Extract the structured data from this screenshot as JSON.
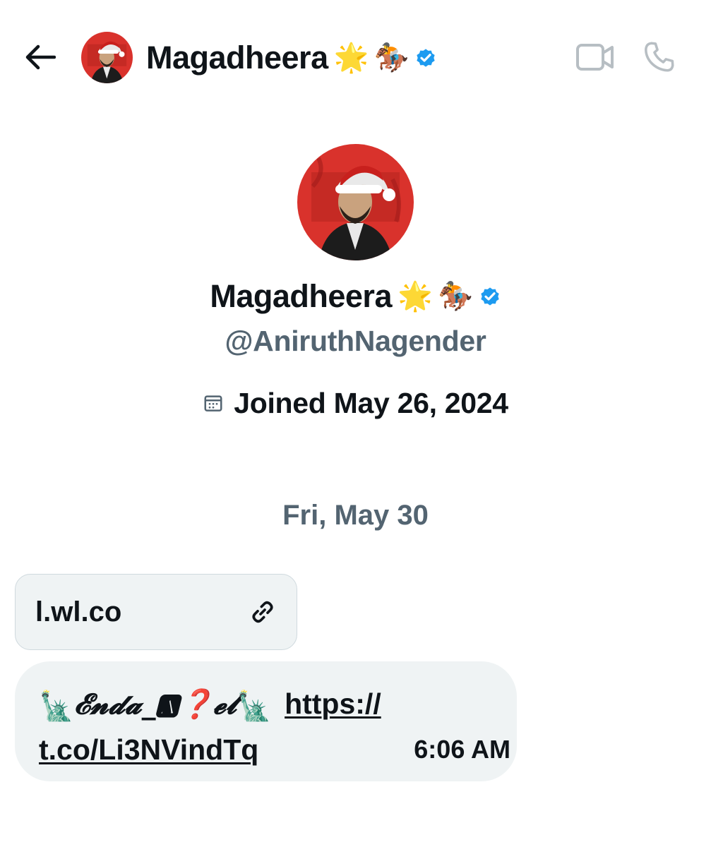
{
  "header": {
    "back_icon": "arrow-left-icon",
    "name": "Magadheera",
    "emoji_star": "🌟",
    "emoji_horse": "🏇",
    "verified_icon": "verified-badge-icon",
    "video_icon": "video-camera-icon",
    "call_icon": "phone-icon"
  },
  "profile": {
    "name": "Magadheera",
    "emoji_star": "🌟",
    "emoji_horse": "🏇",
    "handle": "@AniruthNagender",
    "joined_icon": "calendar-icon",
    "joined": "Joined May 26, 2024"
  },
  "conversation": {
    "date": "Fri, May 30",
    "link_card": {
      "domain": "l.wl.co",
      "icon": "link-icon"
    },
    "message": {
      "statue": "🗽",
      "deco_text": "𝓔𝓷𝓭𝓪_🅰❓𝓮𝓽",
      "statue2": "🗽",
      "link_part1": "https://",
      "link_part2": "t.co/Li3NVindTq",
      "time": "6:06 AM"
    }
  },
  "colors": {
    "text": "#0f1419",
    "secondary": "#536471",
    "bubble": "#eff3f4",
    "verified": "#1d9bf0",
    "icon_gray": "#b7bec3",
    "avatar_bg": "#d9322c"
  }
}
